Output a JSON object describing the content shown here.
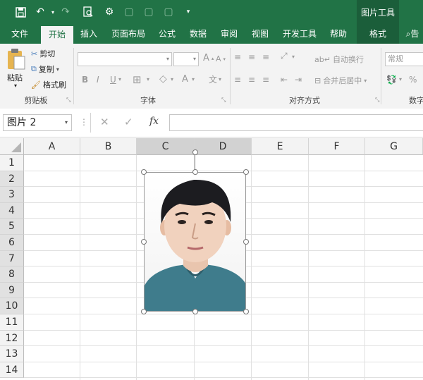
{
  "titlebar": {
    "quick_access": [
      {
        "icon": "save-icon",
        "glyph": "💾"
      },
      {
        "icon": "undo-icon",
        "glyph": "↶"
      },
      {
        "icon": "redo-icon",
        "glyph": "↷"
      },
      {
        "icon": "print-preview-icon",
        "glyph": "🔍"
      },
      {
        "icon": "macro-icon",
        "glyph": "⚙"
      },
      {
        "icon": "qat-icon-1",
        "glyph": "▢"
      },
      {
        "icon": "qat-icon-2",
        "glyph": "▢"
      },
      {
        "icon": "qat-icon-3",
        "glyph": "▢"
      },
      {
        "icon": "customize-qat-icon",
        "glyph": "▾"
      }
    ],
    "context_header": "图片工具"
  },
  "tabs": [
    "文件",
    "开始",
    "插入",
    "页面布局",
    "公式",
    "数据",
    "审阅",
    "视图",
    "开发工具",
    "帮助",
    "格式"
  ],
  "tell_me": "告",
  "ribbon": {
    "clipboard": {
      "paste": "粘贴",
      "cut": "剪切",
      "copy": "复制",
      "format_painter": "格式刷",
      "label": "剪贴板"
    },
    "font": {
      "label": "字体",
      "bold": "B",
      "italic": "I",
      "underline": "U",
      "inc": "A",
      "dec": "A",
      "font_color": "A",
      "phonetic": "文"
    },
    "alignment": {
      "wrap": "自动换行",
      "merge": "合并后居中",
      "label": "对齐方式"
    },
    "number": {
      "format": "常规",
      "percent": "%",
      "label": "数字"
    }
  },
  "formula_bar": {
    "name_box": "图片 2",
    "cancel": "✕",
    "enter": "✓",
    "fx": "fx",
    "value": ""
  },
  "grid": {
    "columns": [
      "A",
      "B",
      "C",
      "D",
      "E",
      "F",
      "G"
    ],
    "selected_columns": [
      "C",
      "D"
    ],
    "rows": [
      "1",
      "2",
      "3",
      "4",
      "5",
      "6",
      "7",
      "8",
      "9",
      "10",
      "11",
      "12",
      "13",
      "14"
    ],
    "selected_rows": [
      "2",
      "3",
      "4",
      "5",
      "6",
      "7",
      "8",
      "9",
      "10"
    ]
  },
  "picture": {
    "name": "图片 2",
    "subject": "portrait photo"
  }
}
